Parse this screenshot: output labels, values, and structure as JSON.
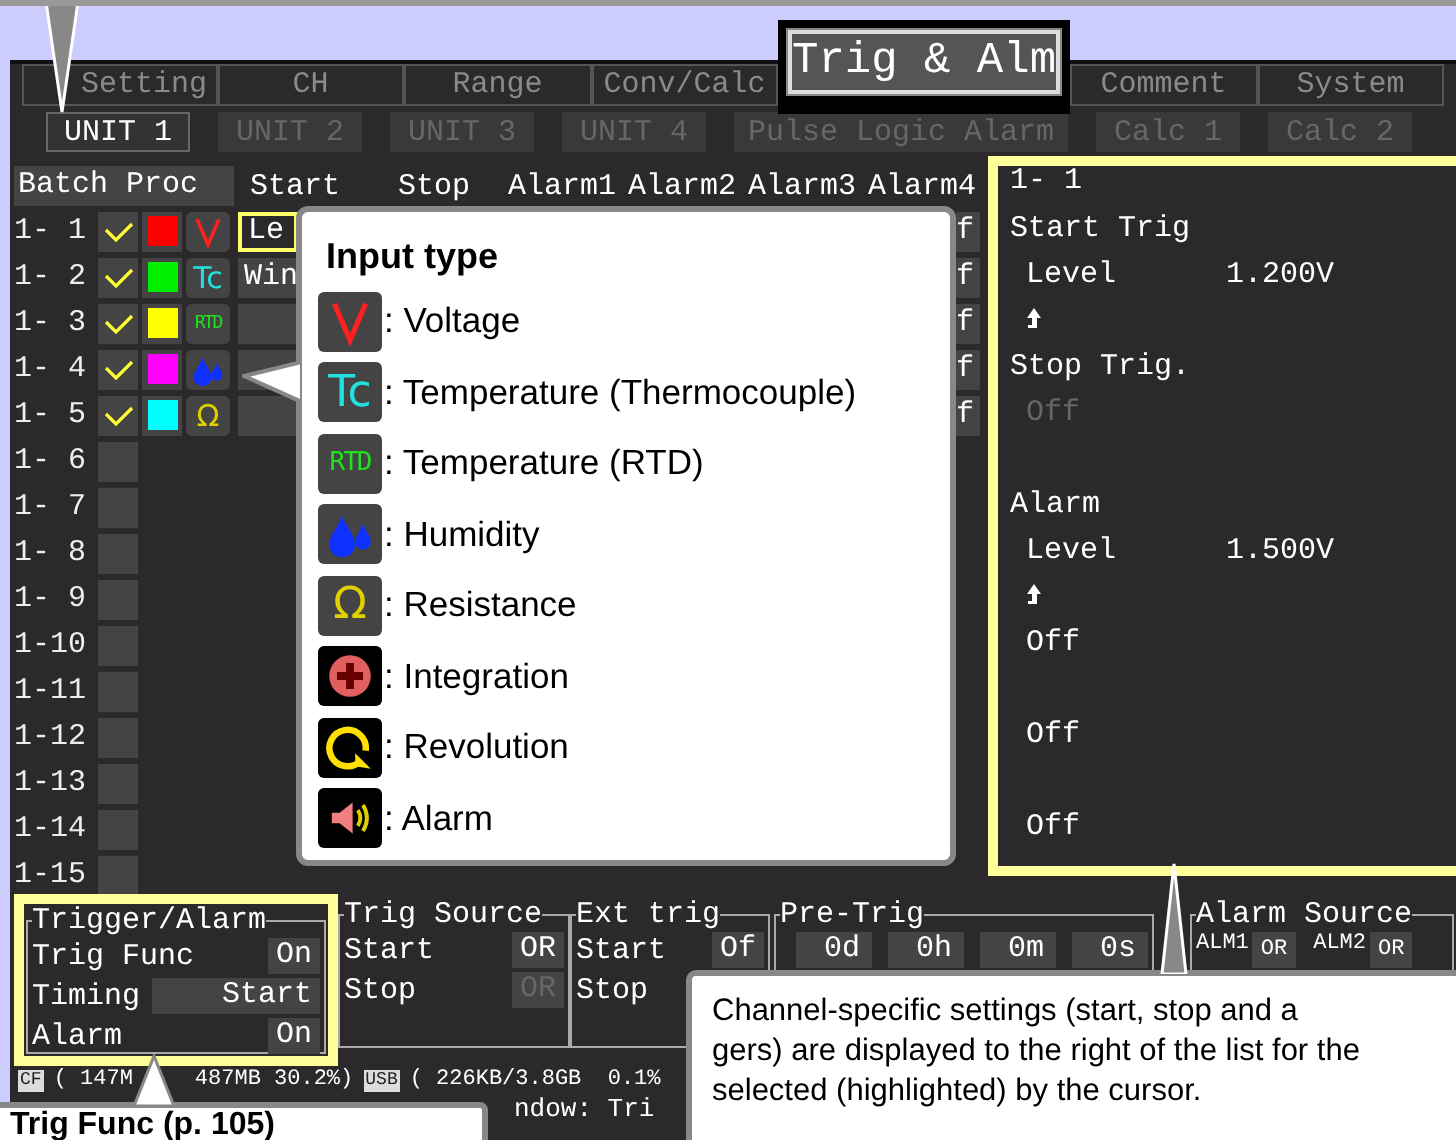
{
  "tabs": [
    {
      "label": "Setting",
      "selected": false
    },
    {
      "label": "CH",
      "selected": false
    },
    {
      "label": "Range",
      "selected": false
    },
    {
      "label": "Conv/Calc",
      "selected": false
    },
    {
      "label": "Trig & Alm",
      "selected": true
    },
    {
      "label": "Comment",
      "selected": false
    },
    {
      "label": "System",
      "selected": false
    }
  ],
  "units": [
    {
      "label": "UNIT 1",
      "selected": true,
      "disabled": false
    },
    {
      "label": "UNIT 2",
      "selected": false,
      "disabled": true
    },
    {
      "label": "UNIT 3",
      "selected": false,
      "disabled": true
    },
    {
      "label": "UNIT 4",
      "selected": false,
      "disabled": true
    },
    {
      "label": "Pulse Logic Alarm",
      "selected": false,
      "disabled": true
    },
    {
      "label": "Calc 1",
      "selected": false,
      "disabled": true
    },
    {
      "label": "Calc 2",
      "selected": false,
      "disabled": true
    }
  ],
  "columns": [
    "Batch Proc",
    "Start",
    "Stop",
    "Alarm1",
    "Alarm2",
    "Alarm3",
    "Alarm4"
  ],
  "channels": [
    {
      "label": "1- 1",
      "checked": true,
      "color": "#ff0000",
      "input_icon": {
        "kind": "voltage"
      },
      "start_cell": "Le",
      "selected": true,
      "alarm4_cell": "f"
    },
    {
      "label": "1- 2",
      "checked": true,
      "color": "#00ee00",
      "input_icon": {
        "kind": "thermocouple",
        "glyph": "Tc"
      },
      "start_cell": "Win",
      "selected": false,
      "alarm4_cell": "f"
    },
    {
      "label": "1- 3",
      "checked": true,
      "color": "#ffff00",
      "input_icon": {
        "kind": "rtd",
        "glyph": "RTD"
      },
      "selected": false,
      "alarm4_cell": "f"
    },
    {
      "label": "1- 4",
      "checked": true,
      "color": "#ff00ff",
      "input_icon": {
        "kind": "humidity"
      },
      "selected": false,
      "alarm4_cell": "f"
    },
    {
      "label": "1- 5",
      "checked": true,
      "color": "#00ffff",
      "input_icon": {
        "kind": "resistance",
        "glyph": "Ω"
      },
      "selected": false,
      "alarm4_cell": "f"
    },
    {
      "label": "1- 6",
      "checked": false,
      "selected": false
    },
    {
      "label": "1- 7",
      "checked": false,
      "selected": false
    },
    {
      "label": "1- 8",
      "checked": false,
      "selected": false
    },
    {
      "label": "1- 9",
      "checked": false,
      "selected": false
    },
    {
      "label": "1-10",
      "checked": false,
      "selected": false
    },
    {
      "label": "1-11",
      "checked": false,
      "selected": false
    },
    {
      "label": "1-12",
      "checked": false,
      "selected": false
    },
    {
      "label": "1-13",
      "checked": false,
      "selected": false
    },
    {
      "label": "1-14",
      "checked": false,
      "selected": false
    },
    {
      "label": "1-15",
      "checked": false,
      "selected": false
    }
  ],
  "input_legend": {
    "title": "Input type",
    "items": [
      {
        "kind": "voltage",
        "label": ": Voltage"
      },
      {
        "kind": "thermocouple",
        "glyph": "Tc",
        "label": ": Temperature (Thermocouple)"
      },
      {
        "kind": "rtd",
        "glyph": "RTD",
        "label": ": Temperature (RTD)"
      },
      {
        "kind": "humidity",
        "label": ": Humidity"
      },
      {
        "kind": "resistance",
        "glyph": "Ω",
        "label": ": Resistance"
      },
      {
        "kind": "integration",
        "label": ": Integration"
      },
      {
        "kind": "revolution",
        "label": ": Revolution"
      },
      {
        "kind": "alarm",
        "label": ": Alarm"
      }
    ]
  },
  "channel_panel": {
    "title": "1- 1",
    "lines": [
      {
        "kind": "heading",
        "text": "Start Trig"
      },
      {
        "kind": "setting",
        "label": "Level",
        "value": "1.200V"
      },
      {
        "kind": "arrow"
      },
      {
        "kind": "heading",
        "text": "Stop Trig."
      },
      {
        "kind": "value",
        "text": "Off",
        "disabled": true
      },
      {
        "kind": "blank"
      },
      {
        "kind": "heading",
        "text": "Alarm"
      },
      {
        "kind": "setting",
        "label": "Level",
        "value": "1.500V"
      },
      {
        "kind": "arrow"
      },
      {
        "kind": "value",
        "text": "Off",
        "disabled": false
      },
      {
        "kind": "blank"
      },
      {
        "kind": "value",
        "text": "Off",
        "disabled": false
      },
      {
        "kind": "blank"
      },
      {
        "kind": "value",
        "text": "Off",
        "disabled": false
      }
    ]
  },
  "groups": [
    {
      "kind": "rows",
      "title": "Trigger/Alarm",
      "highlighted": true,
      "rows": [
        {
          "label": "Trig Func",
          "value": "On",
          "disabled": false,
          "wide": false
        },
        {
          "label": "Timing",
          "value": "Start",
          "disabled": false,
          "wide": true
        },
        {
          "label": "Alarm",
          "value": "On",
          "disabled": false,
          "wide": false
        }
      ]
    },
    {
      "kind": "rows",
      "title": "Trig Source",
      "highlighted": false,
      "rows": [
        {
          "label": "Start",
          "value": "OR",
          "disabled": false,
          "wide": false
        },
        {
          "label": "Stop",
          "value": "OR",
          "disabled": true,
          "wide": false
        }
      ]
    },
    {
      "kind": "rows",
      "title": "Ext trig",
      "highlighted": false,
      "rows": [
        {
          "label": "Start",
          "value": "Of",
          "disabled": false,
          "wide": false
        },
        {
          "label": "Stop"
        }
      ]
    },
    {
      "kind": "fields",
      "title": "Pre-Trig",
      "highlighted": false,
      "fields": [
        "0d",
        "0h",
        "0m",
        "0s"
      ]
    },
    {
      "kind": "pairs",
      "title": "Alarm Source",
      "highlighted": false,
      "pairs": [
        {
          "label": "ALM1",
          "value": "OR"
        },
        {
          "label": "ALM2",
          "value": "OR"
        }
      ]
    }
  ],
  "status_bar": [
    {
      "kind": "badge",
      "text": "CF"
    },
    {
      "kind": "text",
      "text": "( 147M"
    },
    {
      "kind": "text",
      "text": "487MB 30.2%)"
    },
    {
      "kind": "badge",
      "text": "USB"
    },
    {
      "kind": "text",
      "text": "( 226KB/3.8GB  0.1%"
    }
  ],
  "status_line_2": "ndow: Tri",
  "callouts": {
    "channel_settings": [
      "Channel-specific settings (start, stop and a",
      "gers) are displayed to the right of the list for the",
      "selected (highlighted) by the cursor."
    ],
    "trig_func": "Trig Func (p. 105)"
  }
}
